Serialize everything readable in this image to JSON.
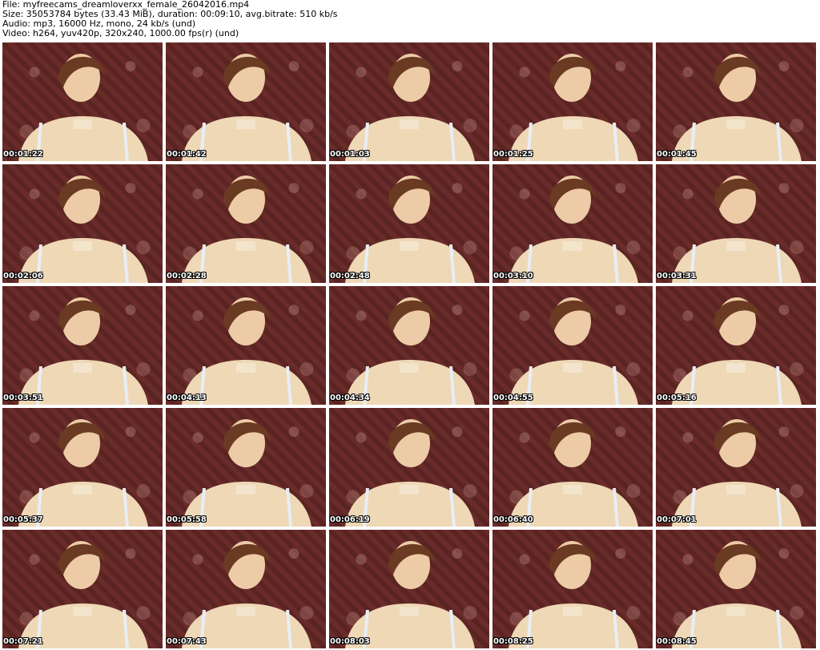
{
  "info": {
    "file": "File: myfreecams_dreamloverxx_female_26042016.mp4",
    "size": "Size: 35053784 bytes (33.43 MiB), duration: 00:09:10, avg.bitrate: 510 kb/s",
    "audio": "Audio: mp3, 16000 Hz, mono, 24 kb/s (und)",
    "video": "Video: h264, yuv420p, 320x240, 1000.00 fps(r) (und)"
  },
  "thumbnails": [
    "00:01:22",
    "00:01:42",
    "00:01:03",
    "00:01:25",
    "00:01:45",
    "00:02:06",
    "00:02:28",
    "00:02:48",
    "00:03:10",
    "00:03:31",
    "00:03:51",
    "00:04:13",
    "00:04:34",
    "00:04:55",
    "00:05:16",
    "00:05:37",
    "00:05:58",
    "00:06:19",
    "00:06:40",
    "00:07:01",
    "00:07:21",
    "00:07:43",
    "00:08:03",
    "00:08:25",
    "00:08:45"
  ]
}
